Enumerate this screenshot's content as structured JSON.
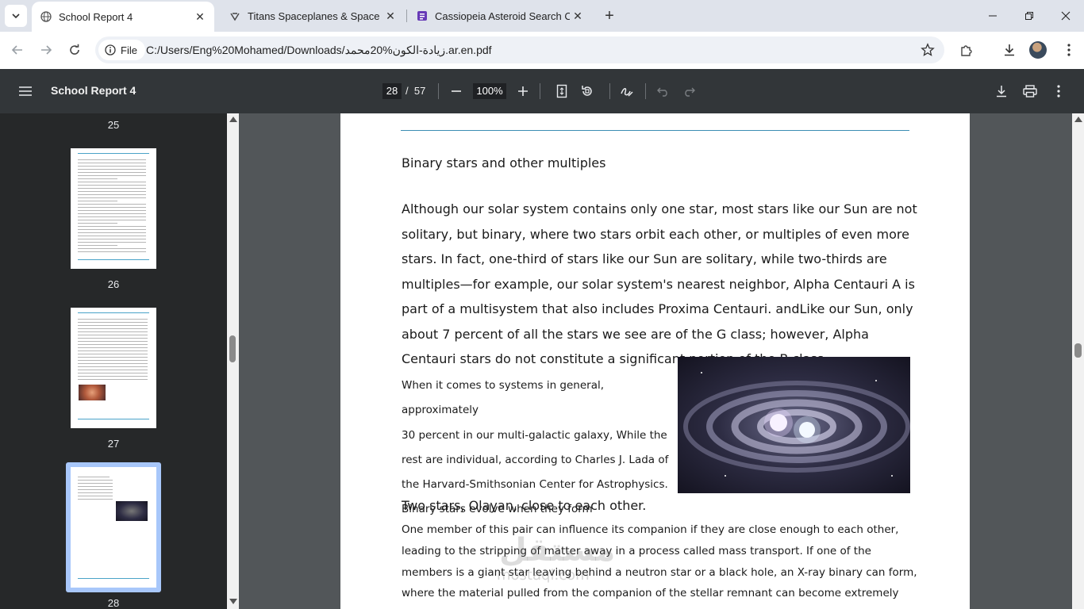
{
  "browser": {
    "tabs": [
      {
        "title": "School Report 4",
        "active": true,
        "icon": "globe-icon"
      },
      {
        "title": "Titans Spaceplanes & Space Tec",
        "active": false,
        "icon": "titans-logo-icon"
      },
      {
        "title": "Cassiopeia Asteroid Search Con",
        "active": false,
        "icon": "forms-icon"
      }
    ],
    "address": {
      "chip_label": "File",
      "url": "C:/Users/Eng%20Mohamed/Downloads/زيادة-الكون%20محمد.ar.en.pdf"
    }
  },
  "pdf": {
    "title": "School Report 4",
    "current_page": "28",
    "page_separator": "/",
    "total_pages": "57",
    "zoom": "100%"
  },
  "thumbnails": [
    {
      "label": "25"
    },
    {
      "label": "26"
    },
    {
      "label": "27"
    },
    {
      "label": "28",
      "selected": true
    }
  ],
  "document": {
    "heading": "Binary stars and other multiples",
    "para1": "Although our solar system contains only one star, most stars like our Sun are not solitary, but binary, where two stars orbit each other, or multiples of even more stars. In fact, one-third of stars like our Sun are solitary, while two-thirds are multiples—for example, our solar system's nearest neighbor, Alpha Centauri A is part of a multisystem that also includes Proxima Centauri. andLike our Sun, only about 7 percent of all the stars we see are of the G class; however, Alpha Centauri stars do not constitute a significant portion of the B class.",
    "para2_lines": [
      "When it comes to systems in general, approximately",
      "30 percent in our multi-galactic galaxy, While the",
      "rest are individual, according to Charles J. Lada of",
      "the Harvard-Smithsonian Center for Astrophysics.",
      "Binary stars evolve when they form"
    ],
    "line3": "Two stars, Olayan, close to each other.",
    "para4": "One member of this pair can influence its companion if they are close enough to each other, leading to the stripping of matter away in a process called mass transport. If one of the members is a giant star leaving behind a neutron star or a black hole, an X-ray binary can form, where the material pulled from the companion of the stellar remnant can become extremely hot.",
    "watermark_main": "مستقل",
    "watermark_sub": "mostaql.com"
  },
  "colors": {
    "accent_rule": "#3b8db3",
    "thumb_selection": "#a8c7fa",
    "pdf_toolbar": "#323639"
  }
}
